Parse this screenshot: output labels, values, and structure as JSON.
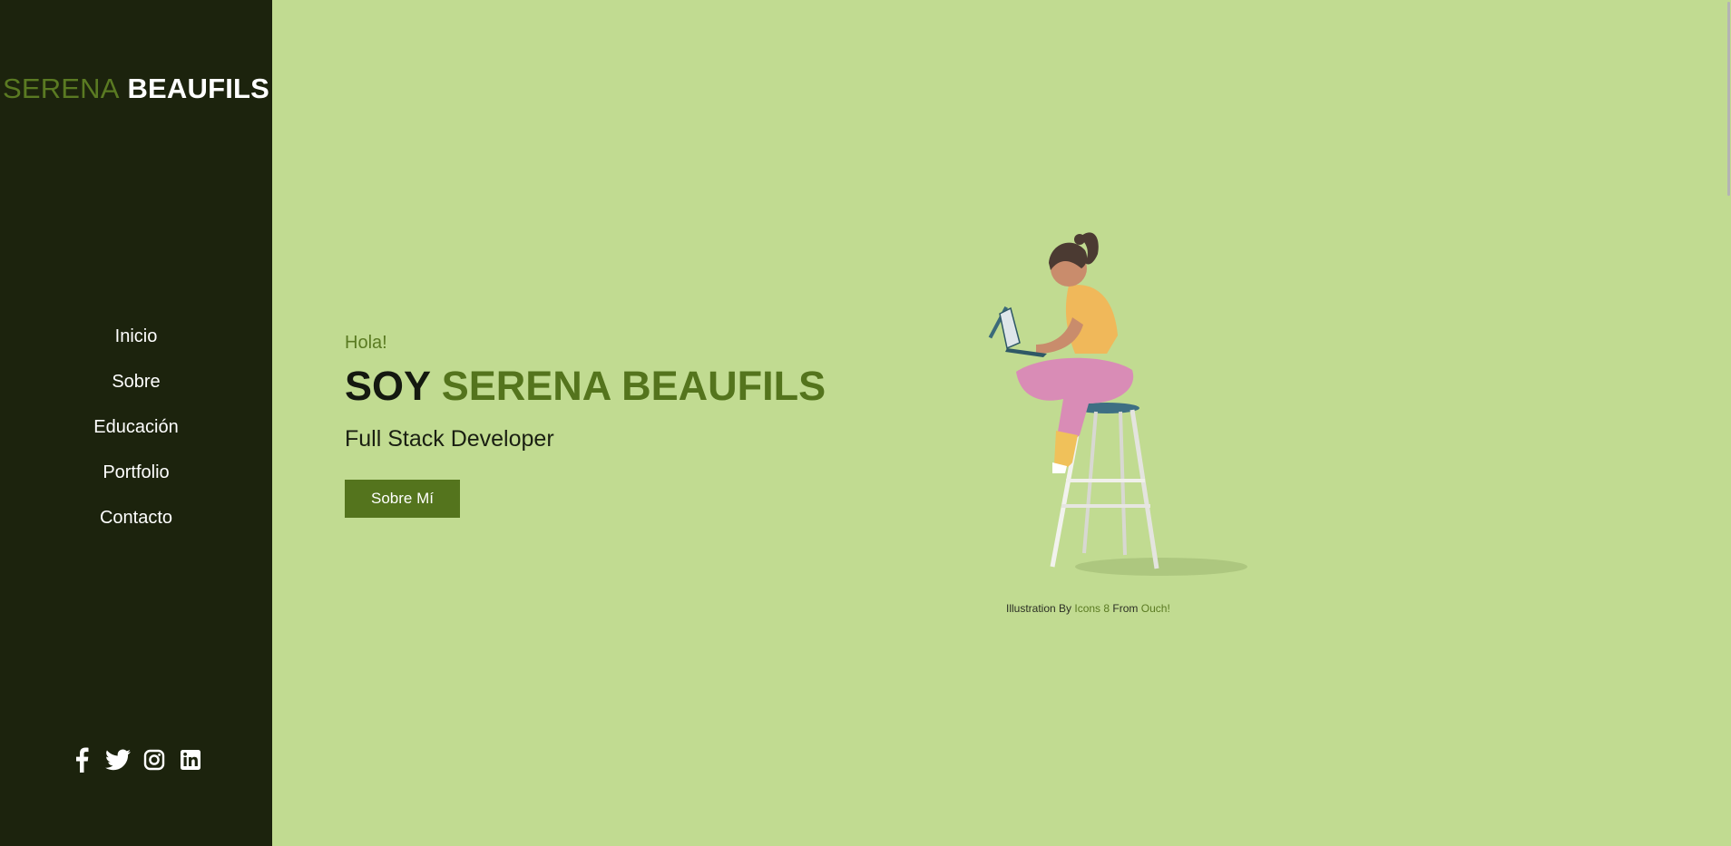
{
  "brand": {
    "first": "SERENA",
    "last": "BEAUFILS"
  },
  "nav": {
    "items": [
      {
        "label": "Inicio"
      },
      {
        "label": "Sobre"
      },
      {
        "label": "Educación"
      },
      {
        "label": "Portfolio"
      },
      {
        "label": "Contacto"
      }
    ]
  },
  "social": {
    "icons": [
      "facebook-icon",
      "twitter-icon",
      "instagram-icon",
      "linkedin-icon"
    ]
  },
  "hero": {
    "greeting": "Hola!",
    "title_prefix": "SOY",
    "title_name": "SERENA BEAUFILS",
    "role": "Full Stack Developer",
    "cta_label": "Sobre Mí"
  },
  "credit": {
    "prefix": "Illustration By",
    "author": "Icons 8",
    "middle": "From",
    "source": "Ouch!"
  },
  "colors": {
    "sidebar_bg": "#1c230d",
    "page_bg": "#c1db91",
    "accent": "#54741d",
    "white": "#ffffff"
  }
}
